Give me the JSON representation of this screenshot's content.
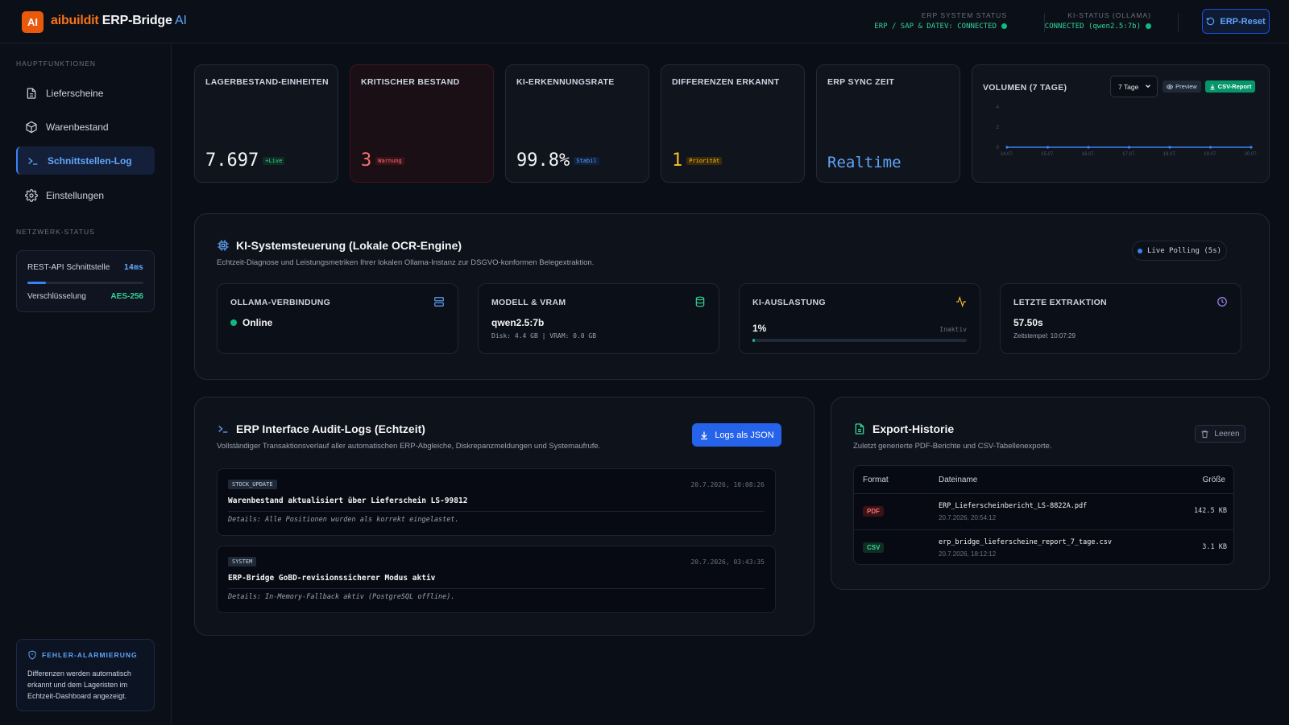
{
  "header": {
    "logo_text": "AI",
    "brand_part1": "aibuildit",
    "brand_part2": " ERP-Bridge",
    "brand_part3": " AI",
    "erp_status_label": "ERP SYSTEM STATUS",
    "erp_status_value": "ERP / SAP & DATEV: CONNECTED",
    "ki_status_label": "KI-STATUS (OLLAMA)",
    "ki_status_value": "CONNECTED (qwen2.5:7b)",
    "reset_label": "ERP-Reset"
  },
  "sidebar": {
    "section_main": "HAUPTFUNKTIONEN",
    "items": [
      {
        "label": "Lieferscheine",
        "icon": "file-icon"
      },
      {
        "label": "Warenbestand",
        "icon": "box-icon"
      },
      {
        "label": "Schnittstellen-Log",
        "icon": "terminal-icon",
        "active": true
      },
      {
        "label": "Einstellungen",
        "icon": "gear-icon"
      }
    ],
    "section_network": "NETZWERK-STATUS",
    "network": {
      "api_label": "REST-API Schnittstelle",
      "api_value": "14ms",
      "api_bar_fraction": 0.16,
      "enc_label": "Verschlüsselung",
      "enc_value": "AES-256"
    },
    "alarm": {
      "title": "FEHLER-ALARMIERUNG",
      "text": "Differenzen werden automatisch erkannt und dem Lageristen im Echtzeit-Dashboard angezeigt."
    }
  },
  "stats": [
    {
      "label": "LAGERBESTAND-EINHEITEN",
      "value": "7.697",
      "badge": "+Live",
      "color": "#f3f4f6",
      "badge_color": "#34d399",
      "badge_bg": "#0f2d22"
    },
    {
      "label": "KRITISCHER BESTAND",
      "value": "3",
      "badge": "Warnung",
      "color": "#f87171",
      "badge_color": "#f87171",
      "badge_bg": "#3b1218"
    },
    {
      "label": "KI-ERKENNUNGSRATE",
      "value": "99.8%",
      "badge": "Stabil",
      "color": "#f3f4f6",
      "badge_color": "#60a5fa",
      "badge_bg": "#10203f"
    },
    {
      "label": "DIFFERENZEN ERKANNT",
      "value": "1",
      "badge": "Priorität",
      "color": "#fbbf24",
      "badge_color": "#fbbf24",
      "badge_bg": "#3a2a0c"
    },
    {
      "label": "ERP SYNC ZEIT",
      "value": "Realtime",
      "badge": "",
      "color": "#60a5fa"
    }
  ],
  "volume": {
    "label": "VOLUMEN (7 TAGE)",
    "select_value": "7 Tage",
    "preview_label": "Preview",
    "csv_label": "CSV-Report"
  },
  "chart_data": {
    "type": "line",
    "categories": [
      "14.07.",
      "15.07.",
      "16.07.",
      "17.07.",
      "18.07.",
      "19.07.",
      "20.07."
    ],
    "series": [
      {
        "values": [
          0,
          0,
          0,
          0,
          0,
          0,
          0
        ]
      }
    ],
    "yticks": [
      "4",
      "2",
      "0"
    ],
    "ylim": [
      0,
      4
    ],
    "color": "#3b82f6",
    "title": "",
    "xlabel": "",
    "ylabel": ""
  },
  "ki": {
    "title": "KI-Systemsteuerung (Lokale OCR-Engine)",
    "subtitle": "Echtzeit-Diagnose und Leistungsmetriken Ihrer lokalen Ollama-Instanz zur DSGVO-konformen Belegextraktion.",
    "live_label": "Live Polling (5s)",
    "cards": {
      "ollama": {
        "label": "OLLAMA-VERBINDUNG",
        "value": "Online"
      },
      "model": {
        "label": "MODELL & VRAM",
        "value": "qwen2.5:7b",
        "sub": "Disk: 4.4 GB | VRAM: 0.0 GB"
      },
      "load": {
        "label": "KI-AUSLASTUNG",
        "value": "1%",
        "status": "Inaktiv",
        "fraction": 0.01
      },
      "last": {
        "label": "LETZTE EXTRAKTION",
        "value": "57.50s",
        "sub": "Zeitstempel: 10:07:29"
      }
    }
  },
  "logs": {
    "title": "ERP Interface Audit-Logs (Echtzeit)",
    "subtitle": "Vollständiger Transaktionsverlauf aller automatischen ERP-Abgleiche, Diskrepanzmeldungen und Systemaufrufe.",
    "json_label": "Logs als JSON",
    "entries": [
      {
        "tag": "STOCK_UPDATE",
        "time": "20.7.2026, 10:08:26",
        "message": "Warenbestand aktualisiert über Lieferschein LS-99812",
        "details": "Details: Alle Positionen wurden als korrekt eingelastet."
      },
      {
        "tag": "SYSTEM",
        "time": "20.7.2026, 03:43:35",
        "message": "ERP-Bridge GoBD-revisionssicherer Modus aktiv",
        "details": "Details: In-Memory-Fallback aktiv (PostgreSQL offline)."
      }
    ]
  },
  "export": {
    "title": "Export-Historie",
    "subtitle": "Zuletzt generierte PDF-Berichte und CSV-Tabellenexporte.",
    "clear_label": "Leeren",
    "columns": [
      "Format",
      "Dateiname",
      "Größe"
    ],
    "rows": [
      {
        "format": "PDF",
        "name": "ERP_Lieferscheinbericht_LS-8822A.pdf",
        "date": "20.7.2026, 20:54:12",
        "size": "142.5 KB",
        "fmt_color": "#f87171",
        "fmt_bg": "#3b1218"
      },
      {
        "format": "CSV",
        "name": "erp_bridge_lieferscheine_report_7_tage.csv",
        "date": "20.7.2026, 18:12:12",
        "size": "3.1 KB",
        "fmt_color": "#34d399",
        "fmt_bg": "#0f2d22"
      }
    ]
  }
}
